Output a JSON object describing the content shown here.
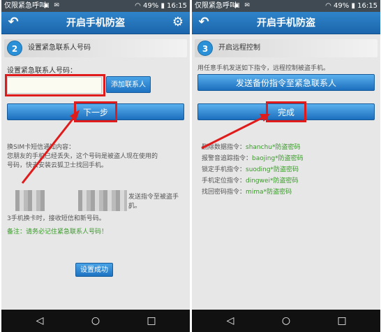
{
  "status": {
    "carrier": "仅限紧急呼叫",
    "battery": "49%",
    "time": "16:15"
  },
  "left": {
    "title": "开启手机防盗",
    "step_number": "2",
    "step_title": "设置紧急联系人号码",
    "field_label": "设置紧急联系人号码：",
    "input_value": "",
    "add_button": "添加联系人",
    "next_button": "下一步",
    "sms_heading": "换SIM卡短信通知内容：",
    "sms_body_1": "您朋友的手机已经丢失，这个号码是被盗人现在使用的",
    "sms_body_2": "号码，快去安装云狐卫士找回手机。",
    "partial_1": "发送指令至被盗手机。",
    "partial_2": "。",
    "partial_3": "3手机换卡时，接收短信和新号码。",
    "note": "备注：请务必记住紧急联系人号码！",
    "success_button": "设置成功"
  },
  "right": {
    "title": "开启手机防盗",
    "step_number": "3",
    "step_title": "开启远程控制",
    "instruction": "用任意手机发送如下指令，远程控制被盗手机。",
    "send_button": "发送备份指令至紧急联系人",
    "done_button": "完成",
    "commands": [
      {
        "label": "删除数据指令：",
        "cmd": "shanchu*防盗密码"
      },
      {
        "label": "报警音追踪指令：",
        "cmd": "baojing*防盗密码"
      },
      {
        "label": "锁定手机指令：",
        "cmd": "suoding*防盗密码"
      },
      {
        "label": "手机定位指令：",
        "cmd": "dingwei*防盗密码"
      },
      {
        "label": "找回密码指令：",
        "cmd": "mima*防盗密码"
      }
    ]
  },
  "colors": {
    "accent": "#1c66ad",
    "highlight": "#e01b1b",
    "green_text": "#3a9a2a"
  }
}
